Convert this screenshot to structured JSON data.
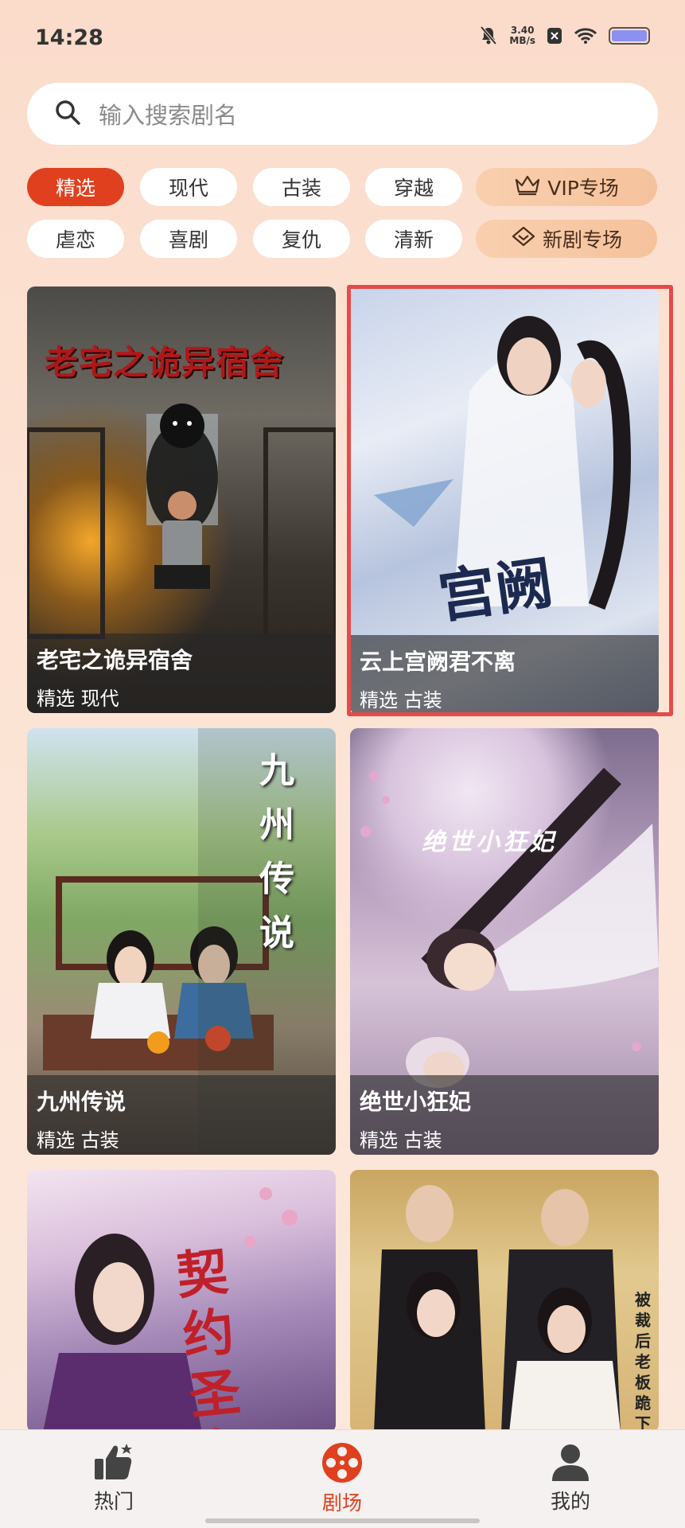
{
  "status_bar": {
    "time": "14:28",
    "net_speed_value": "3.40",
    "net_speed_unit": "MB/s",
    "icons": [
      "bell-muted-icon",
      "close-badge-icon",
      "wifi-icon",
      "battery-icon"
    ]
  },
  "search": {
    "placeholder": "输入搜索剧名",
    "icon": "search-icon"
  },
  "categories": {
    "row1": [
      "精选",
      "现代",
      "古装",
      "穿越"
    ],
    "row1_special": "VIP专场",
    "row2": [
      "虐恋",
      "喜剧",
      "复仇",
      "清新"
    ],
    "row2_special": "新剧专场",
    "active": "精选"
  },
  "dramas": [
    {
      "title": "老宅之诡异宿舍",
      "tags": "精选 现代",
      "poster_text": "老宅之诡异宿舍"
    },
    {
      "title": "云上宫阙君不离",
      "tags": "精选 古装",
      "poster_text": "宫阙"
    },
    {
      "title": "九州传说",
      "tags": "精选 古装",
      "poster_text": "九州传说"
    },
    {
      "title": "绝世小狂妃",
      "tags": "精选 古装",
      "poster_text": "绝世小狂妃"
    },
    {
      "title": "",
      "tags": "",
      "poster_text": "契约圣女"
    },
    {
      "title": "",
      "tags": "",
      "poster_text": "被裁后老板跪下求"
    }
  ],
  "bottom_nav": [
    {
      "label": "热门",
      "icon": "thumbs-up-icon"
    },
    {
      "label": "剧场",
      "icon": "film-reel-icon",
      "active": true
    },
    {
      "label": "我的",
      "icon": "user-icon"
    }
  ],
  "colors": {
    "accent": "#e0401e",
    "highlight_border": "#e44b4b",
    "vip_chip": "#f7c8a4"
  }
}
